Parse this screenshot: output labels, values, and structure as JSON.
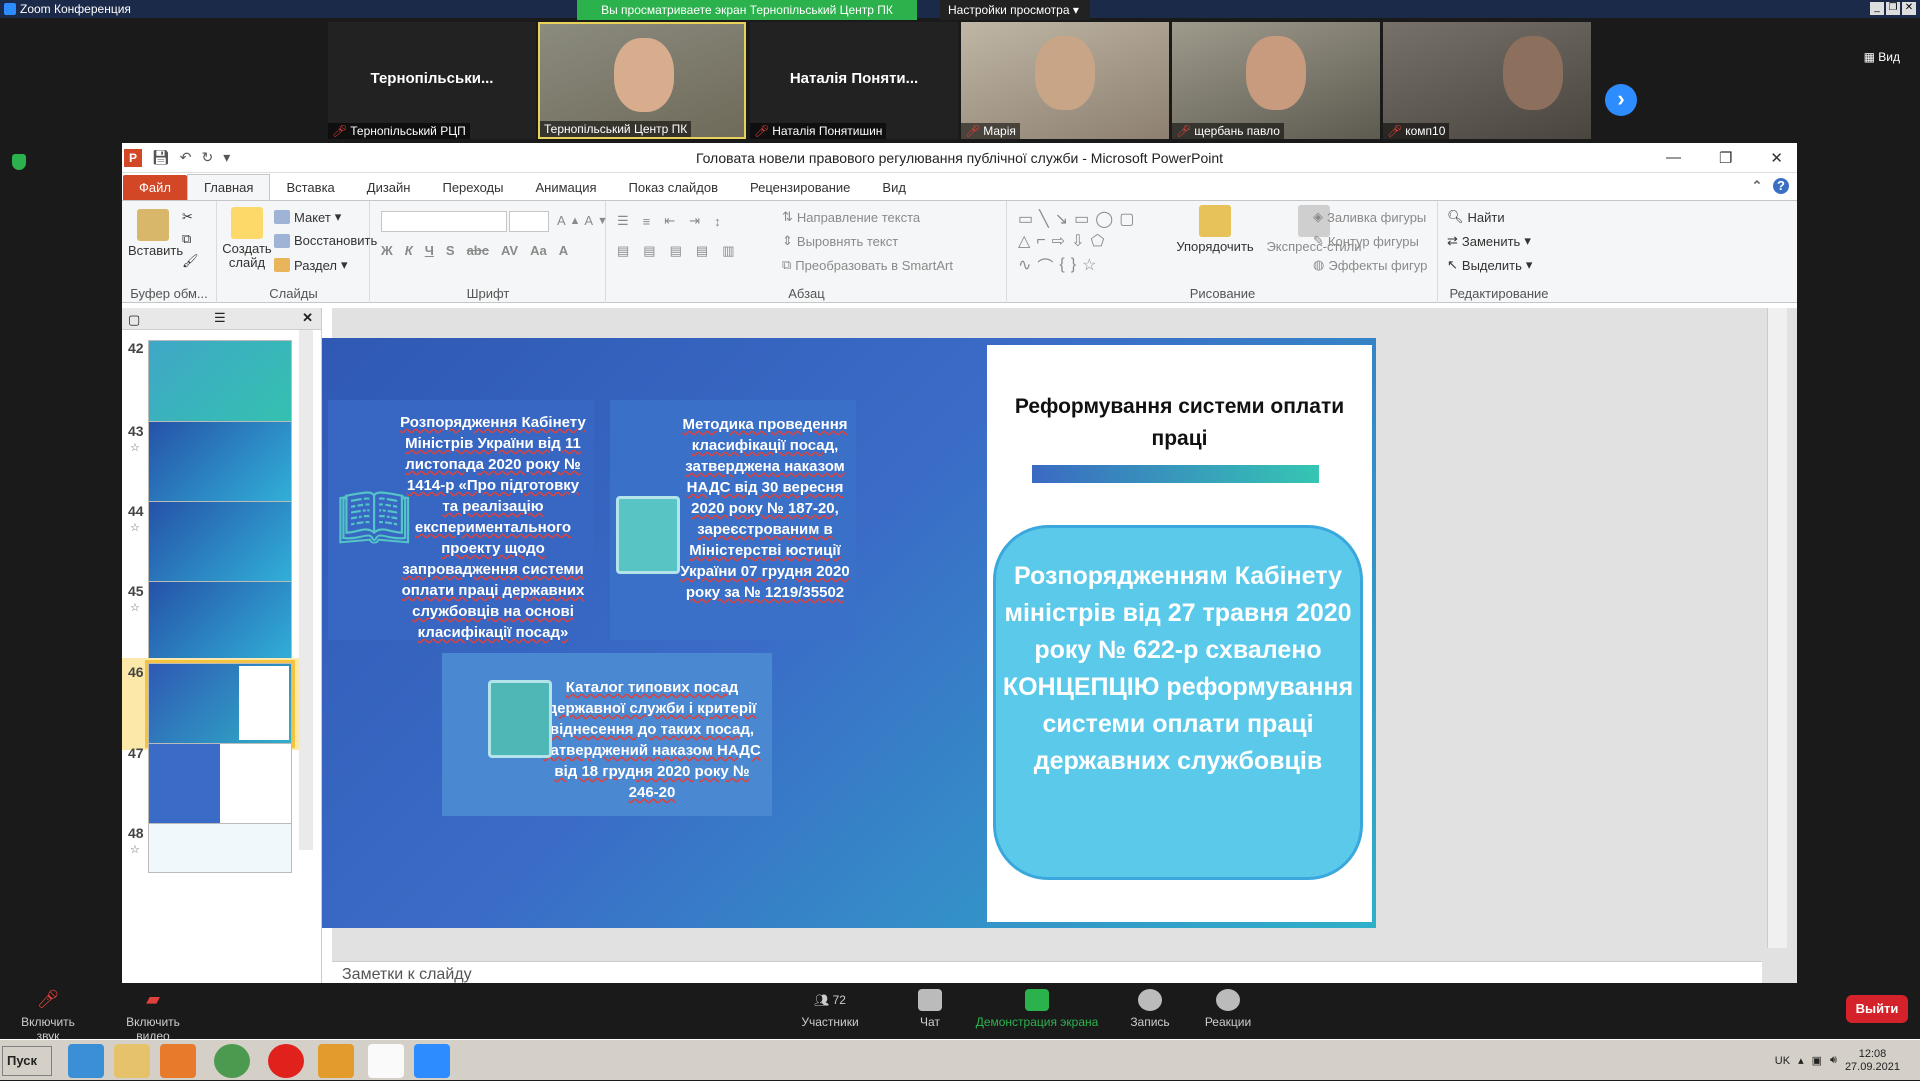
{
  "zoom": {
    "window_title": "Zoom Конференция",
    "share_banner": "Вы просматриваете экран Тернопільський Центр ПК",
    "view_settings": "Настройки просмотра",
    "view_button": "Вид",
    "tiles": [
      {
        "name": "Тернопільськи...",
        "caption": "Тернопільський РЦП",
        "type": "name"
      },
      {
        "name": "",
        "caption": "Тернопільський Центр ПК",
        "type": "video"
      },
      {
        "name": "Наталія Поняти...",
        "caption": "Наталія Понятишин",
        "type": "name"
      },
      {
        "name": "",
        "caption": "Марія",
        "type": "video"
      },
      {
        "name": "",
        "caption": "щербань павло",
        "type": "video"
      },
      {
        "name": "",
        "caption": "комп10",
        "type": "video"
      }
    ],
    "toolbar": {
      "unmute": "Включить звук",
      "start_video": "Включить видео",
      "participants": "Участники",
      "participants_count": "72",
      "chat": "Чат",
      "share": "Демонстрация экрана",
      "record": "Запись",
      "reactions": "Реакции",
      "leave": "Выйти"
    }
  },
  "pp": {
    "title": "Головата новели правового регулювання публічної служби  -  Microsoft PowerPoint",
    "tabs": [
      "Файл",
      "Главная",
      "Вставка",
      "Дизайн",
      "Переходы",
      "Анимация",
      "Показ слайдов",
      "Рецензирование",
      "Вид"
    ],
    "ribbon": {
      "paste": "Вставить",
      "clipboard": "Буфер обм...",
      "new_slide": "Создать слайд",
      "layout": "Макет",
      "reset": "Восстановить",
      "section": "Раздел",
      "slides": "Слайды",
      "font": "Шрифт",
      "paragraph": "Абзац",
      "text_direction": "Направление текста",
      "align_text": "Выровнять текст",
      "smartart": "Преобразовать в SmartArt",
      "arrange": "Упорядочить",
      "quick_styles": "Экспресс-стили",
      "shape_fill": "Заливка фигуры",
      "shape_outline": "Контур фигуры",
      "shape_effects": "Эффекты фигур",
      "drawing": "Рисование",
      "find": "Найти",
      "replace": "Заменить",
      "select": "Выделить",
      "editing": "Редактирование"
    },
    "thumb_numbers": [
      "42",
      "43",
      "44",
      "45",
      "46",
      "47",
      "48"
    ],
    "notes_placeholder": "Заметки к слайду"
  },
  "slide": {
    "card1": "Розпорядження Кабінету Міністрів України від 11 листопада 2020 року № 1414-р «Про підготовку та реалізацію експериментального проекту щодо запровадження системи оплати праці державних службовців на основі класифікації посад»",
    "card2": "Методика проведення класифікації посад, затверджена наказом НАДС від 30 вересня 2020 року № 187-20, зареєстрованим в Міністерстві юстиції України 07 грудня 2020 року за № 1219/35502",
    "card3": "Каталог  типових посад державної  служби  і критерії віднесення до таких посад, затверджений наказом НАДС від 18 грудня 2020 року № 246-20",
    "panel_heading": "Реформування  системи оплати праці",
    "panel_bubble": "Розпорядженням Кабінету міністрів від 27 травня 2020 року № 622-р схвалено КОНЦЕПЦІЮ реформування системи оплати праці державних службовців"
  },
  "taskbar": {
    "start": "Пуск",
    "lang": "UK",
    "time": "12:08",
    "date": "27.09.2021"
  }
}
